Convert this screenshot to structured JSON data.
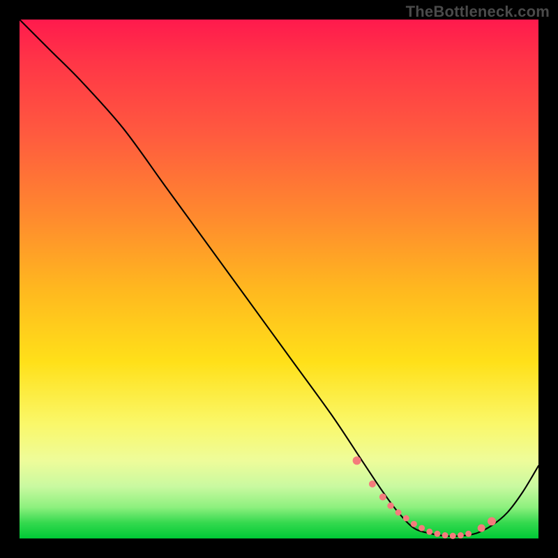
{
  "watermark": "TheBottleneck.com",
  "colors": {
    "background": "#000000",
    "curve": "#000000",
    "dot": "#f47c7c",
    "gradient_stops": [
      "#ff1a4d",
      "#ff3547",
      "#ff5a3f",
      "#ff8a2e",
      "#ffb81f",
      "#ffe019",
      "#faf86a",
      "#eefc9a",
      "#c9f9a0",
      "#8df07e",
      "#34d94e",
      "#00c936"
    ]
  },
  "chart_data": {
    "type": "line",
    "title": "",
    "xlabel": "",
    "ylabel": "",
    "xlim": [
      0,
      100
    ],
    "ylim": [
      0,
      100
    ],
    "grid": false,
    "legend": false,
    "series": [
      {
        "name": "bottleneck-curve",
        "x": [
          0,
          6,
          12,
          20,
          28,
          36,
          44,
          52,
          60,
          66,
          70,
          73,
          76,
          79,
          82,
          85,
          88,
          91,
          94,
          97,
          100
        ],
        "y": [
          100,
          94,
          88,
          79,
          68,
          57,
          46,
          35,
          24,
          15,
          9,
          5,
          2,
          1,
          0.5,
          0.5,
          1,
          2.5,
          5,
          9,
          14
        ]
      }
    ],
    "marker_points": {
      "name": "highlight-dots",
      "x": [
        65,
        68,
        70,
        71.5,
        73,
        74.5,
        76,
        77.5,
        79,
        80.5,
        82,
        83.5,
        85,
        86.5,
        89,
        91
      ],
      "y": [
        15,
        10.5,
        8,
        6.3,
        5,
        3.9,
        2.8,
        2.0,
        1.3,
        0.9,
        0.6,
        0.5,
        0.6,
        0.9,
        2.0,
        3.3
      ],
      "r": [
        6,
        5,
        5,
        4.7,
        4.5,
        4.5,
        4.5,
        4.5,
        4.5,
        4.5,
        4.5,
        4.5,
        4.5,
        4.5,
        5.5,
        6
      ]
    }
  }
}
